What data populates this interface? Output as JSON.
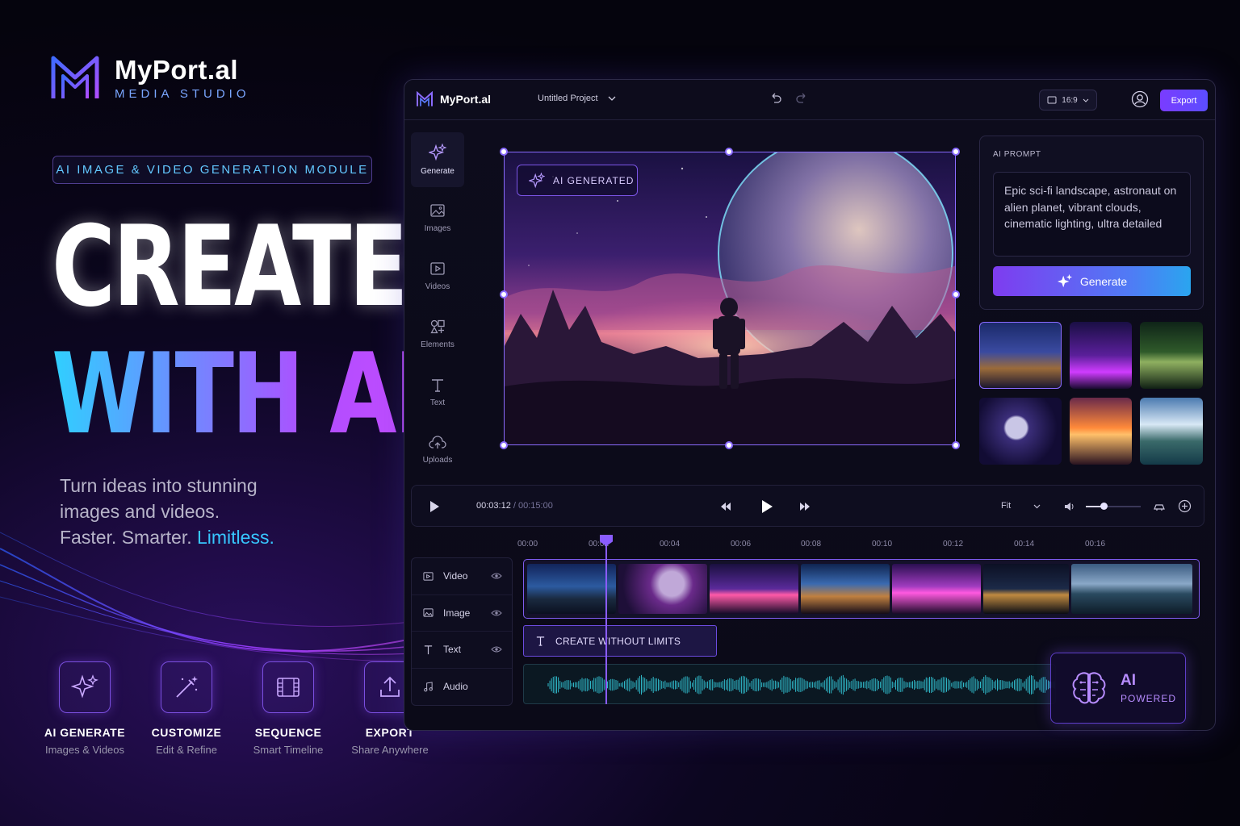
{
  "brand": {
    "name": "MyPort.al",
    "subtitle": "MEDIA STUDIO"
  },
  "module_badge": "AI IMAGE & VIDEO GENERATION MODULE",
  "hero": {
    "line1": "CREATE",
    "line2": "WITH AI"
  },
  "tagline": {
    "line1": "Turn ideas into stunning",
    "line2": "images and videos.",
    "line3_prefix": "Faster. Smarter. ",
    "line3_highlight": "Limitless."
  },
  "features": [
    {
      "title": "AI GENERATE",
      "sub": "Images & Videos",
      "icon": "sparkles-icon"
    },
    {
      "title": "CUSTOMIZE",
      "sub": "Edit & Refine",
      "icon": "magic-wand-icon"
    },
    {
      "title": "SEQUENCE",
      "sub": "Smart Timeline",
      "icon": "film-icon"
    },
    {
      "title": "EXPORT",
      "sub": "Share Anywhere",
      "icon": "upload-icon"
    }
  ],
  "app": {
    "brand": "MyPort.al",
    "project": "Untitled Project",
    "ratio": "16:9",
    "export_label": "Export",
    "sidebar": [
      {
        "label": "Generate",
        "icon": "sparkles-icon",
        "active": true
      },
      {
        "label": "Images",
        "icon": "image-icon"
      },
      {
        "label": "Videos",
        "icon": "video-icon"
      },
      {
        "label": "Elements",
        "icon": "shapes-icon"
      },
      {
        "label": "Text",
        "icon": "text-icon"
      },
      {
        "label": "Uploads",
        "icon": "cloud-upload-icon"
      }
    ],
    "ai_generated_badge": "AI GENERATED",
    "prompt": {
      "label": "AI PROMPT",
      "text": "Epic sci-fi landscape, astronaut on alien planet, vibrant clouds, cinematic lighting, ultra detailed",
      "generate_label": "Generate"
    },
    "transport": {
      "current": "00:03:12",
      "separator": " / ",
      "total": "00:15:00",
      "fit": "Fit",
      "volume": 0.3
    },
    "ruler": [
      "00:00",
      "00:02",
      "00:04",
      "00:06",
      "00:08",
      "00:10",
      "00:12",
      "00:14",
      "00:16"
    ],
    "tracks": [
      {
        "label": "Video",
        "icon": "video-track-icon"
      },
      {
        "label": "Image",
        "icon": "image-track-icon"
      },
      {
        "label": "Text",
        "icon": "text-track-icon"
      },
      {
        "label": "Audio",
        "icon": "audio-track-icon"
      }
    ],
    "text_clip": "CREATE WITHOUT LIMITS",
    "ai_powered": {
      "line1": "AI",
      "line2": "POWERED"
    }
  },
  "colors": {
    "accent": "#8a5cff",
    "cyan": "#37c7ff",
    "background": "#05040d"
  }
}
